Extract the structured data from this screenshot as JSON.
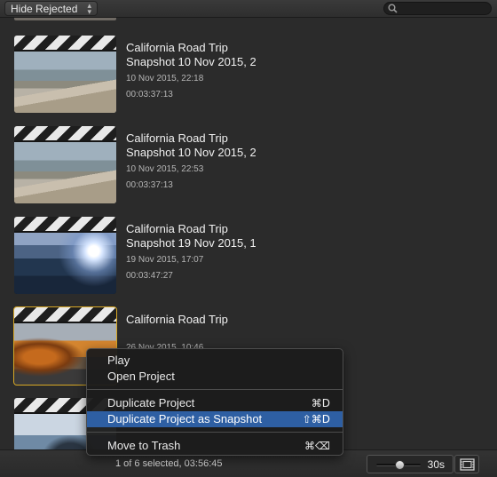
{
  "toolbar": {
    "filter_label": "Hide Rejected",
    "filter_arrows": "▴▾",
    "search_placeholder": ""
  },
  "projects": [
    {
      "title1": "California Road Trip",
      "title2": "Snapshot 10 Nov 2015, 2",
      "date": "10 Nov 2015, 22:18",
      "duration": "00:03:37:13",
      "thumbnail": "beach"
    },
    {
      "title1": "California Road Trip",
      "title2": "Snapshot 10 Nov 2015, 2",
      "date": "10 Nov 2015, 22:53",
      "duration": "00:03:37:13",
      "thumbnail": "beach"
    },
    {
      "title1": "California Road Trip",
      "title2": "Snapshot 19 Nov 2015, 1",
      "date": "19 Nov 2015, 17:07",
      "duration": "00:03:47:27",
      "thumbnail": "sunset"
    },
    {
      "title1": "California Road Trip",
      "title2": "",
      "date": "26 Nov 2015, 10:46",
      "duration": "",
      "thumbnail": "autumn",
      "selected": true
    },
    {
      "title1": "",
      "title2": "",
      "date": "",
      "duration": "",
      "thumbnail": "rocks"
    }
  ],
  "status": {
    "selection_text": "1 of 6 selected, 03:56:45"
  },
  "zoom": {
    "label": "30s",
    "level": 0.55
  },
  "context_menu": {
    "items": [
      {
        "label": "Play",
        "shortcut": ""
      },
      {
        "label": "Open Project",
        "shortcut": ""
      },
      {
        "label": "Duplicate Project",
        "shortcut": "⌘D"
      },
      {
        "label": "Duplicate Project as Snapshot",
        "shortcut": "⇧⌘D",
        "highlighted": true
      },
      {
        "label": "Move to Trash",
        "shortcut": "⌘⌫"
      }
    ]
  },
  "colors": {
    "selection_outline": "#d8a825",
    "menu_highlight": "#2e5fa3"
  }
}
